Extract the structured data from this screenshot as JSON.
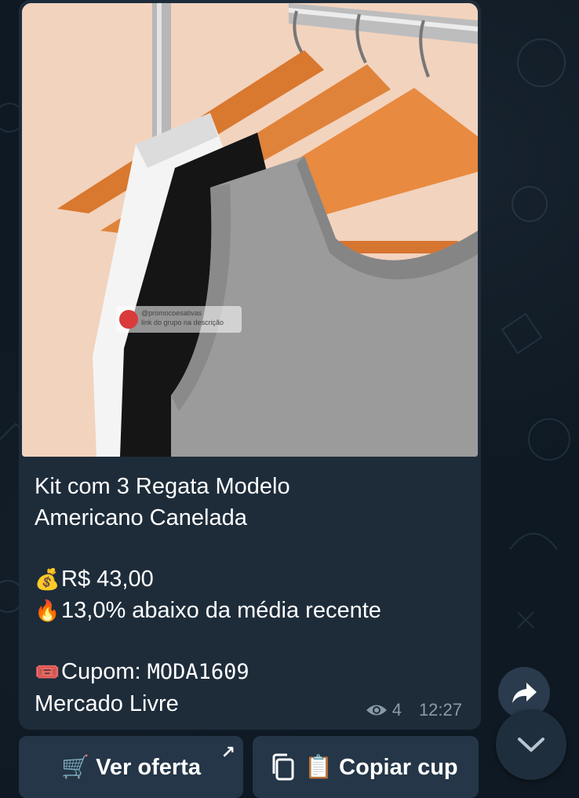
{
  "message": {
    "title_lines": [
      "Kit com 3 Regata Modelo",
      "Americano Canelada"
    ],
    "price_emoji": "💰",
    "price": "R$ 43,00",
    "fire_emoji": "🔥",
    "discount": "13,0% abaixo da média recente",
    "ticket_emoji": "🎟️",
    "coupon_label": "Cupom: ",
    "coupon_code": "MODA1609",
    "store": "Mercado Livre",
    "views": "4",
    "time": "12:27"
  },
  "image": {
    "watermark_line1": "@promocoesativas",
    "watermark_line2": "link do grupo na descrição"
  },
  "buttons": {
    "offer_label": "🛒 Ver oferta",
    "offer_arrow": "↗",
    "copy_label": "📋 Copiar cup"
  },
  "icons": [
    "eye-icon",
    "share-icon",
    "chevron-down-icon",
    "copy-icon",
    "external-link-icon"
  ],
  "colors": {
    "background": "#0f1923",
    "bubble": "#1e2c3a",
    "button": "#243648",
    "meta_text": "#8b9aa8"
  }
}
